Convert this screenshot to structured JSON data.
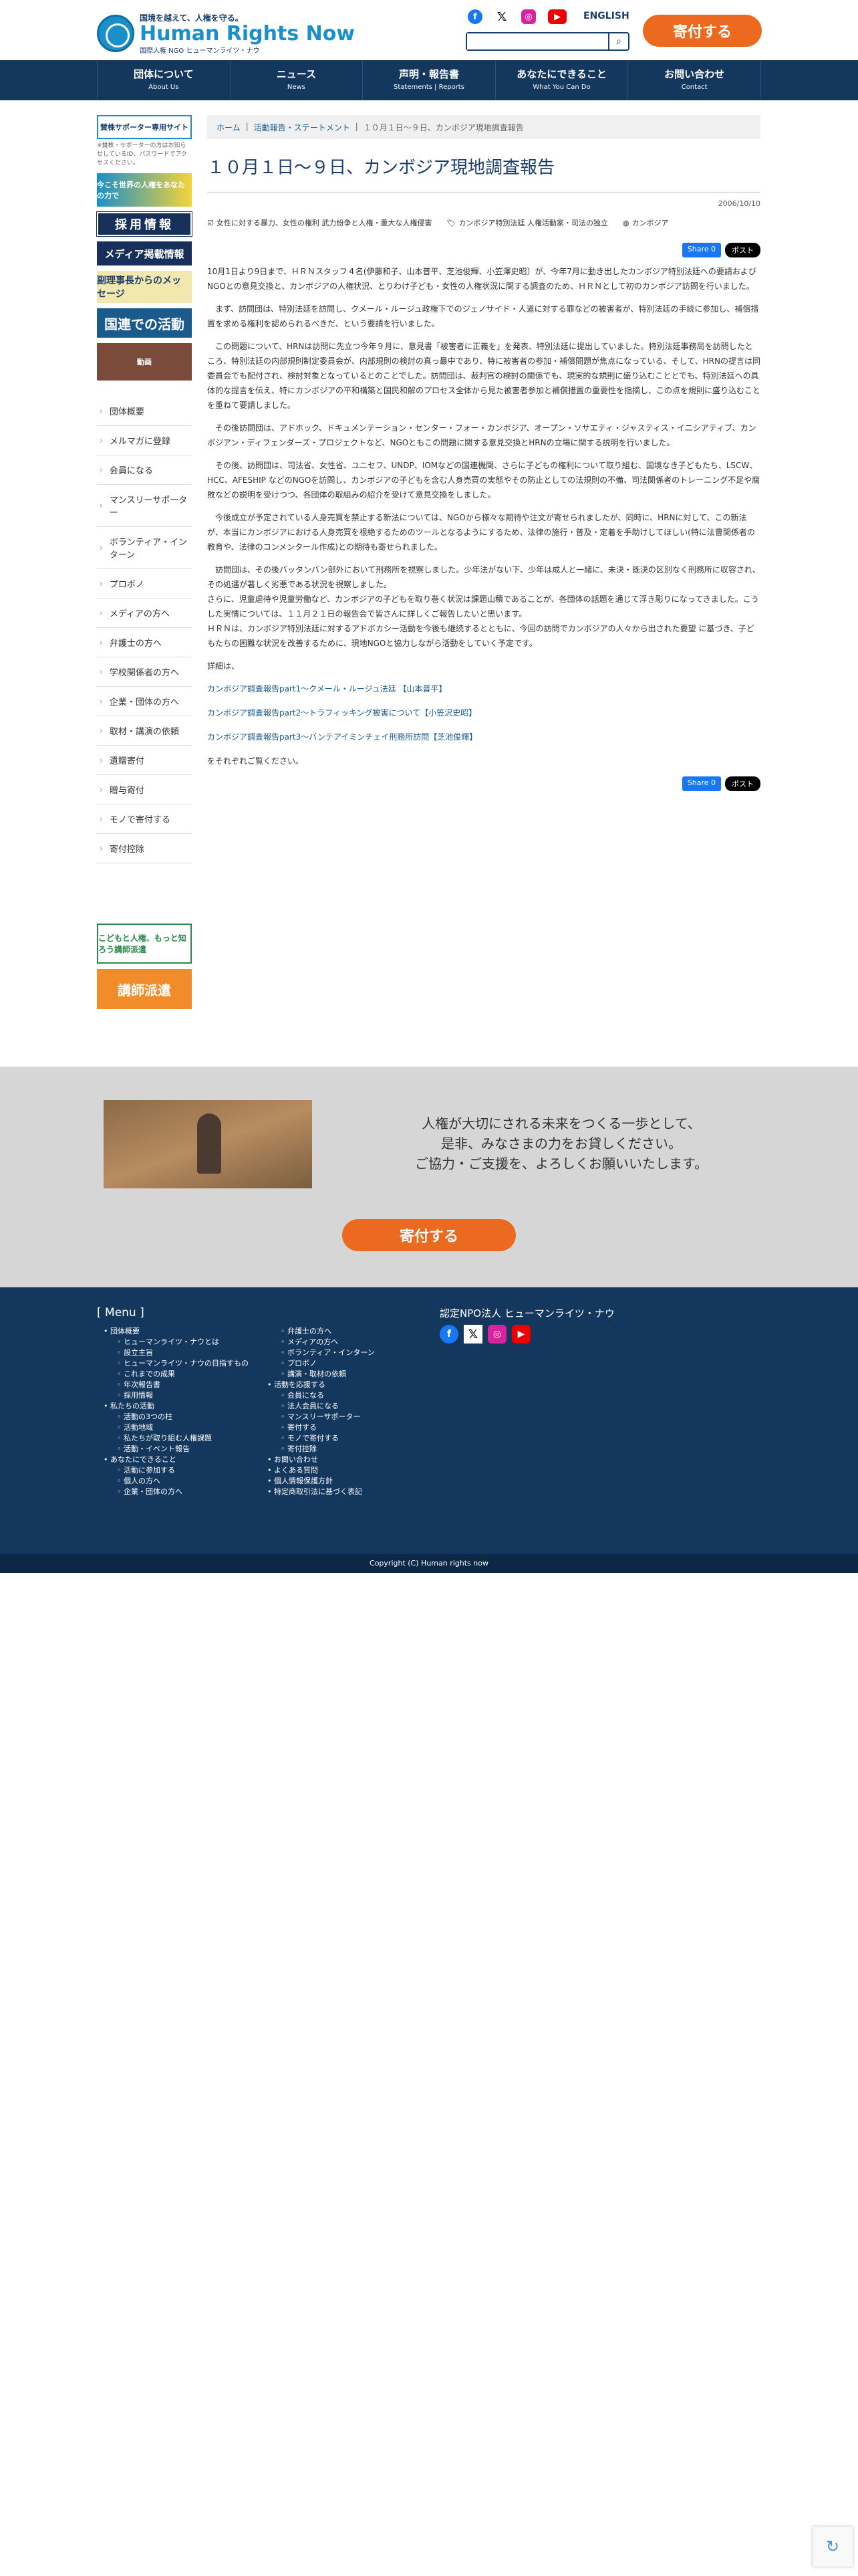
{
  "header": {
    "tagline": "国境を越えて、人権を守る。",
    "logo_name": "Human Rights Now",
    "logo_sub": "国際人権 NGO ヒューマンライツ・ナウ",
    "english": "ENGLISH",
    "search_placeholder": "",
    "donate_label": "寄付する"
  },
  "nav": [
    {
      "ja": "団体について",
      "en": "About Us"
    },
    {
      "ja": "ニュース",
      "en": "News"
    },
    {
      "ja": "声明・報告書",
      "en": "Statements | Reports"
    },
    {
      "ja": "あなたにできること",
      "en": "What You Can Do"
    },
    {
      "ja": "お問い合わせ",
      "en": "Contact"
    }
  ],
  "sidebar": {
    "support_banner": "賛株サポーター専用サイト",
    "support_note": "※賛株・サポーターの方はお知らせしているID、パスワードでアクセスください。",
    "yellow_banner": "今こそ世界の人権をあなたの力で",
    "recruit_banner": "採用情報",
    "media_banner": "メディア掲載情報",
    "message_banner": "副理事長からのメッセージ",
    "un_banner": "国連での活動",
    "video_banner": "動画",
    "menu": [
      "団体概要",
      "メルマガに登録",
      "会員になる",
      "マンスリーサポーター",
      "ボランティア・インターン",
      "プロボノ",
      "メディアの方へ",
      "弁護士の方へ",
      "学校関係者の方へ",
      "企業・団体の方へ",
      "取材・講演の依頼",
      "遺贈寄付",
      "贈与寄付",
      "モノで寄付する",
      "寄付控除"
    ],
    "kids_banner": "こどもと人権、もっと知ろう講師派遣",
    "lecture_banner": "講師派遣"
  },
  "breadcrumb": {
    "home": "ホーム",
    "category": "活動報告・ステートメント",
    "current": "１０月１日～９日、カンボジア現地調査報告"
  },
  "article": {
    "title": "１０月１日～９日、カンボジア現地調査報告",
    "date": "2006/10/10",
    "tags": [
      "女性に対する暴力、女性の権利 武力紛争と人権・重大な人権侵害",
      "カンボジア特別法廷 人権活動家・司法の独立",
      "カンボジア"
    ],
    "share_fb": "Share 0",
    "share_x": "ポスト",
    "paragraphs": [
      "10月1日より9日まで、ＨＲＮスタッフ４名(伊藤和子、山本普平、芝池俊輝、小笠澤史昭）が、今年7月に動き出したカンボジア特別法廷への要請およびNGOとの意見交換と、カンボジアの人権状況、とりわけ子ども・女性の人権状況に関する調査のため、ＨＲＮとして初のカンボジア訪問を行いました。",
      "まず、訪問団は、特別法廷を訪問し、クメール・ルージュ政権下でのジェノサイド・人道に対する罪などの被害者が、特別法廷の手続に参加し、補償措置を求める権利を認められるべきだ、という要請を行いました。",
      "この問題について、HRNは訪問に先立つ今年９月に、意見書「被害者に正義を」を発表、特別法廷に提出していました。特別法廷事務局を訪問したところ、特別法廷の内部規則制定委員会が、内部規則の検討の真っ最中であり、特に被害者の参加・補償問題が焦点になっている、そして、HRNの提言は同委員会でも配付され、検討対象となっているとのことでした。訪問団は、裁判官の検討の関係でも、現実的な規則に盛り込むこととでも、特別法廷への具体的な提言を伝え、特にカンボジアの平和構築と国民和解のプロセス全体から見た被害者参加と補償措置の重要性を指摘し、この点を規則に盛り込むことを重ねて要請しました。",
      "その後訪問団は、アドホック、ドキュメンテーション・センター・フォー・カンボジア、オープン・ソサエティ・ジャスティス・イニシアティブ、カンボジアン・ディフェンダーズ・プロジェクトなど、NGOともこの問題に関する意見交換とHRNの立場に関する説明を行いました。",
      "その後、訪問団は、司法省、女性省、ユニセフ、UNDP、IOMなどの国連機関、さらに子どもの権利について取り組む、国境なき子どもたち、LSCW、HCC、AFESHIP などのNGOを訪問し、カンボジアの子どもを含む人身売買の実態やその防止としての法規則の不備、司法関係者のトレーニング不足や腐敗などの説明を受けつつ、各団体の取組みの紹介を受けて意見交換をしました。",
      "今後成立が予定されている人身売買を禁止する新法については、NGOから様々な期待や注文が寄せられましたが、同時に、HRNに対して、この新法が、本当にカンボジアにおける人身売買を根絶するためのツールとなるようにするため、法律の施行・普及・定着を手助けしてほしい(特に法曹関係者の教育や、法律のコンメンタール作成)との期待も寄せられました。",
      "訪問団は、その後バッタンバン部外において刑務所を視察しました。少年法がない下、少年は成人と一緒に、未決・既決の区別なく刑務所に収容され、その処遇が著しく劣悪である状況を視察しました。",
      "さらに、児童虐待や児童労働など、カンボジアの子どもを取り巻く状況は課題山積であることが、各団体の話題を通じて浮き彫りになってきました。こうした実情については、１１月２１日の報告会で皆さんに詳しくご報告したいと思います。",
      "ＨＲＮは、カンボジア特別法廷に対するアドボカシー活動を今後も継続するとともに、今回の訪問でカンボジアの人々から出された要望 に基づき、子どもたちの困難な状況を改善するために、現地NGOと協力しながら活動をしていく予定です。",
      "詳細は、"
    ],
    "links": [
      "カンボジア調査報告part1～クメール・ルージュ法廷 【山本普平】",
      "カンボジア調査報告part2～トラフィッキング被害について【小笠沢史昭】",
      "カンボジア調査報告part3～バンテアイミンチェイ刑務所訪問【芝池俊輝】"
    ],
    "closing": "をそれぞれご覧ください。"
  },
  "appeal": {
    "line1": "人権が大切にされる未来をつくる一歩として、",
    "line2": "是非、みなさまの力をお貸しください。",
    "line3": "ご協力・ご支援を、よろしくお願いいたします。",
    "donate_label": "寄付する"
  },
  "footer": {
    "menu_title": "[ Menu ]",
    "col1": [
      {
        "t": "団体概要",
        "sub": false
      },
      {
        "t": "ヒューマンライツ・ナウとは",
        "sub": true
      },
      {
        "t": "設立主旨",
        "sub": true
      },
      {
        "t": "ヒューマンライツ・ナウの目指すもの",
        "sub": true
      },
      {
        "t": "これまでの成果",
        "sub": true
      },
      {
        "t": "年次報告書",
        "sub": true
      },
      {
        "t": "採用情報",
        "sub": true
      },
      {
        "t": "私たちの活動",
        "sub": false
      },
      {
        "t": "活動の3つの柱",
        "sub": true
      },
      {
        "t": "活動地域",
        "sub": true
      },
      {
        "t": "私たちが取り組む人権課題",
        "sub": true
      },
      {
        "t": "活動・イベント報告",
        "sub": true
      },
      {
        "t": "あなたにできること",
        "sub": false
      },
      {
        "t": "活動に参加する",
        "sub": true
      },
      {
        "t": "個人の方へ",
        "sub": true
      },
      {
        "t": "企業・団体の方へ",
        "sub": true
      }
    ],
    "col2": [
      {
        "t": "弁護士の方へ",
        "sub": true
      },
      {
        "t": "メディアの方へ",
        "sub": true
      },
      {
        "t": "ボランティア・インターン",
        "sub": true
      },
      {
        "t": "プロボノ",
        "sub": true
      },
      {
        "t": "講演・取材の依頼",
        "sub": true
      },
      {
        "t": "活動を応援する",
        "sub": false
      },
      {
        "t": "会員になる",
        "sub": true
      },
      {
        "t": "法人会員になる",
        "sub": true
      },
      {
        "t": "マンスリーサポーター",
        "sub": true
      },
      {
        "t": "寄付する",
        "sub": true
      },
      {
        "t": "モノで寄付する",
        "sub": true
      },
      {
        "t": "寄付控除",
        "sub": true
      },
      {
        "t": "お問い合わせ",
        "sub": false
      },
      {
        "t": "よくある質問",
        "sub": false
      },
      {
        "t": "個人情報保護方針",
        "sub": false
      },
      {
        "t": "特定商取引法に基づく表記",
        "sub": false
      }
    ],
    "org_name": "認定NPO法人 ヒューマンライツ・ナウ",
    "copyright": "Copyright (C) Human rights now"
  },
  "colors": {
    "navy": "#14375e",
    "orange": "#ec6a1f",
    "link": "#1a5a8c"
  }
}
